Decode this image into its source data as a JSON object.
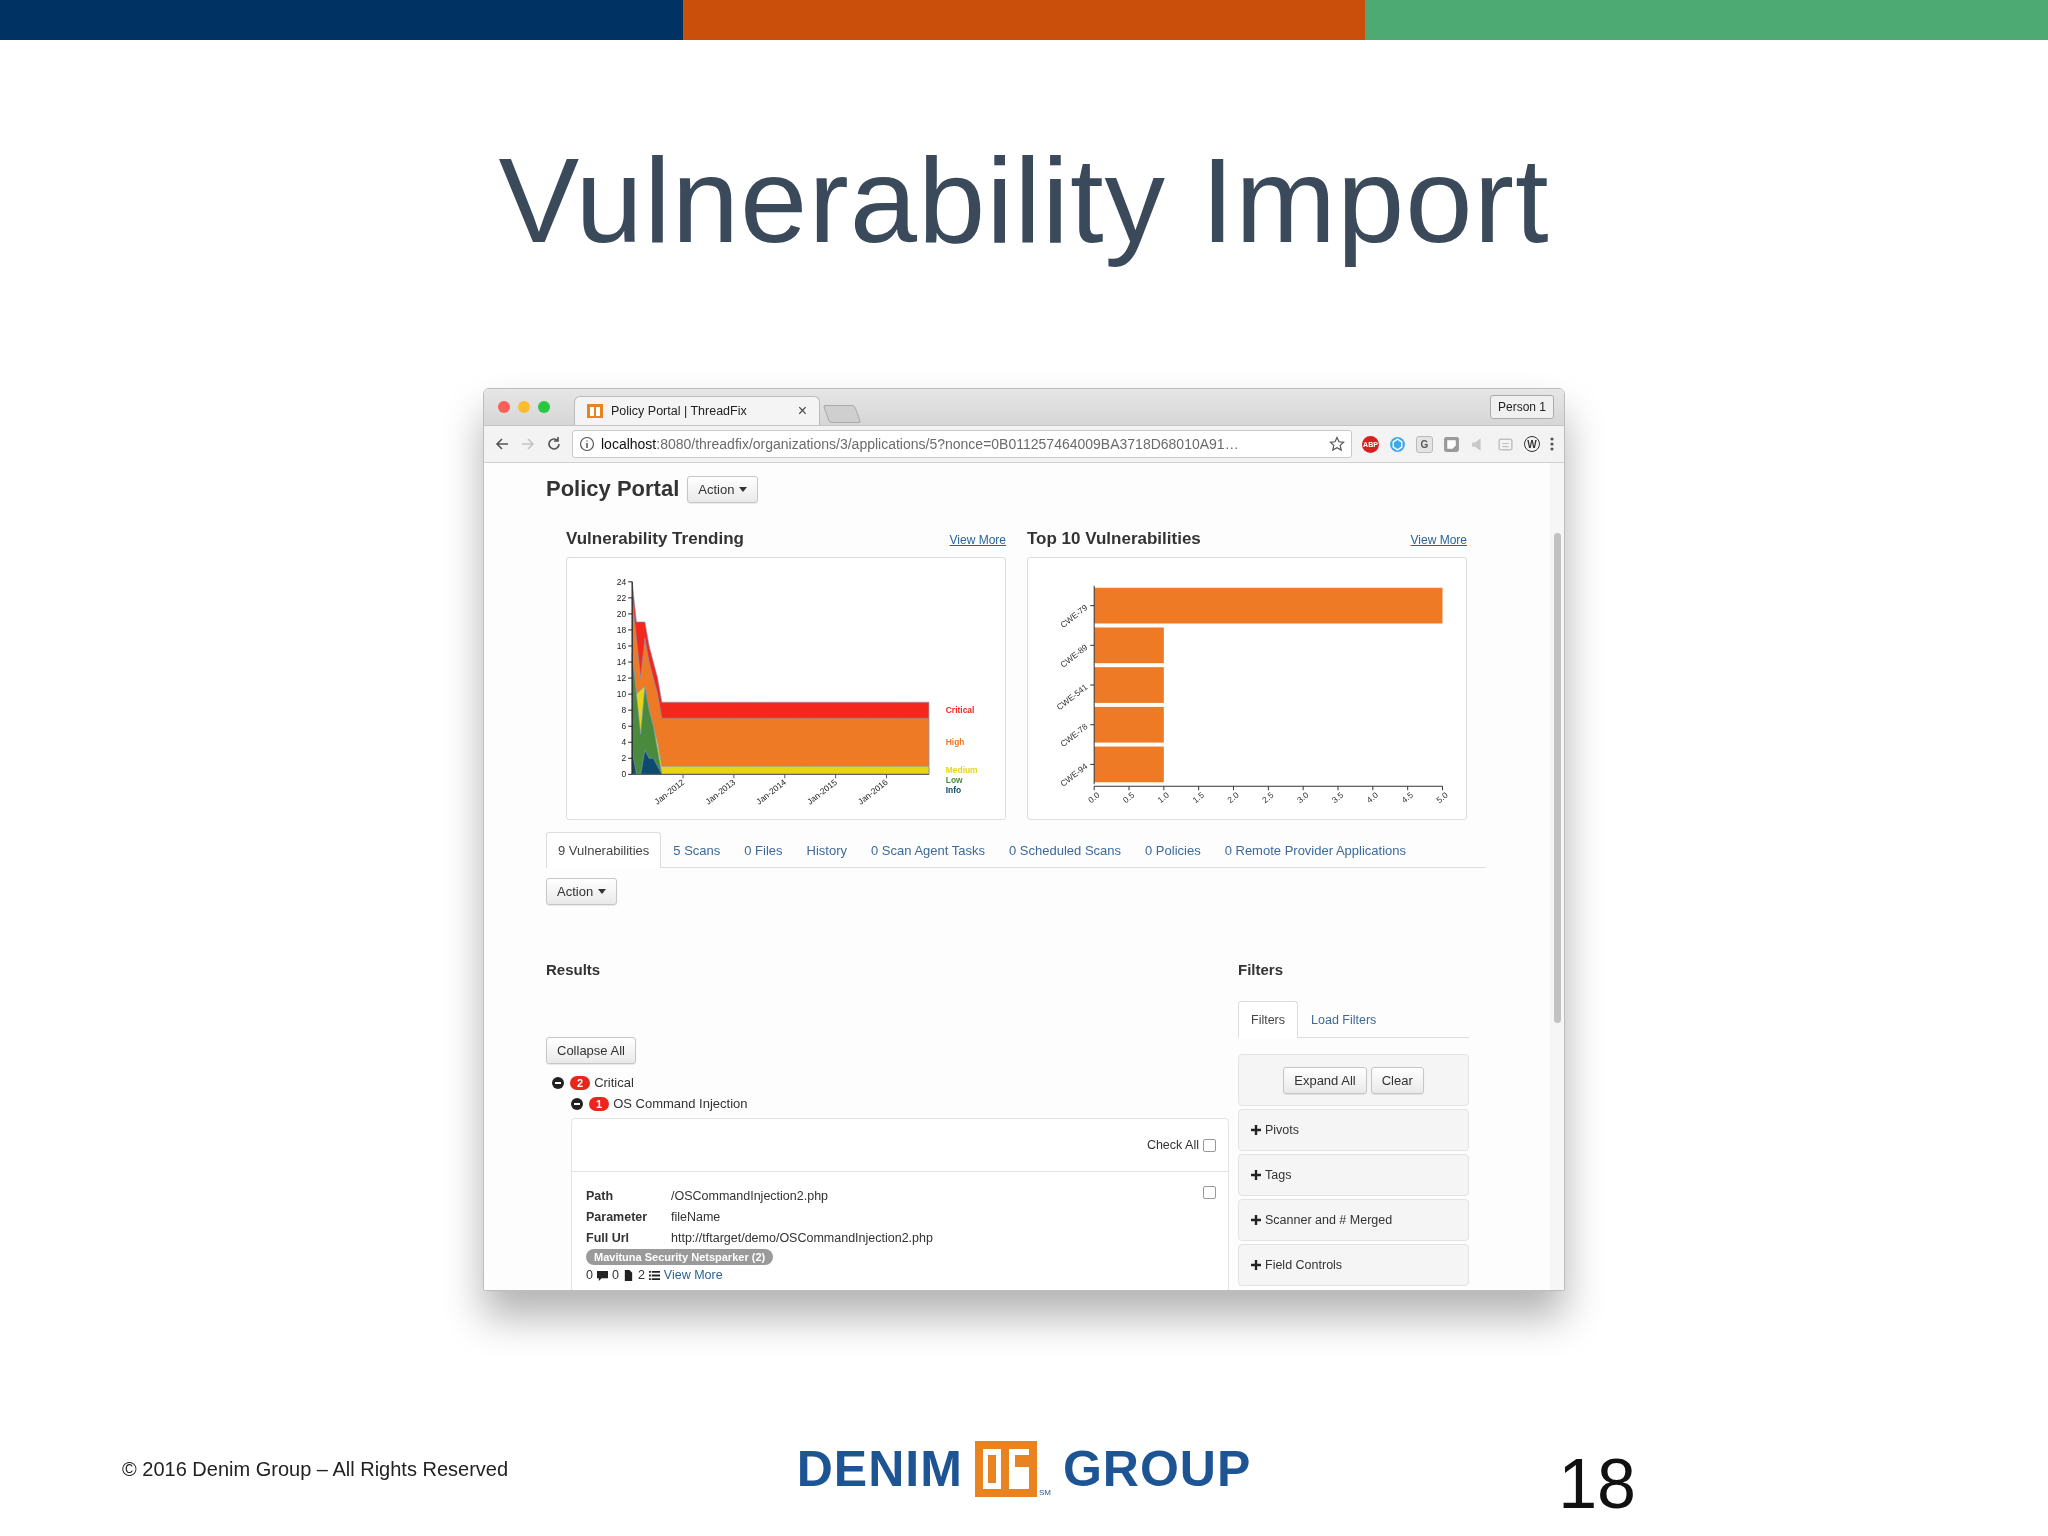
{
  "slide": {
    "title": "Vulnerability Import",
    "footer": {
      "copyright": "© 2016 Denim Group – All Rights Reserved",
      "logo_left": "DENIM",
      "logo_right": "GROUP",
      "logo_mark": "SM",
      "page_number": "18"
    }
  },
  "browser": {
    "tab_title": "Policy Portal | ThreadFix",
    "tab_close": "×",
    "profile": "Person 1",
    "back_disabled": false,
    "forward_disabled": true,
    "url_host": "localhost",
    "url_rest": ":8080/threadfix/organizations/3/applications/5?nonce=0B011257464009BA3718D68010A91…",
    "extensions": [
      {
        "kind": "abp",
        "label": "ABP"
      },
      {
        "kind": "cube"
      },
      {
        "kind": "letter",
        "label": "G"
      },
      {
        "kind": "note"
      },
      {
        "kind": "speaker"
      },
      {
        "kind": "box"
      },
      {
        "kind": "ring",
        "label": "W"
      }
    ]
  },
  "page": {
    "title": "Policy Portal",
    "action": "Action",
    "panels": [
      {
        "heading": "Vulnerability Trending",
        "link": "View More",
        "chart_data": {
          "type": "area",
          "stacked": false,
          "categories": [
            null,
            null,
            null,
            null,
            null,
            null,
            null,
            null,
            null,
            null,
            null,
            null,
            "Jan-2012",
            null,
            null,
            null,
            null,
            null,
            null,
            null,
            null,
            null,
            null,
            null,
            "Jan-2013",
            null,
            null,
            null,
            null,
            null,
            null,
            null,
            null,
            null,
            null,
            null,
            "Jan-2014",
            null,
            null,
            null,
            null,
            null,
            null,
            null,
            null,
            null,
            null,
            null,
            "Jan-2015",
            null,
            null,
            null,
            null,
            null,
            null,
            null,
            null,
            null,
            null,
            null,
            "Jan-2016",
            null,
            null,
            null,
            null,
            null,
            null,
            null,
            null,
            null,
            null
          ],
          "ylim": [
            0,
            24
          ],
          "yticks": [
            0,
            2,
            4,
            6,
            8,
            10,
            12,
            14,
            16,
            18,
            20,
            22,
            24
          ],
          "series": [
            {
              "name": "Info",
              "color": "#0c4a6e",
              "values": [
                3,
                0,
                0,
                3,
                2,
                2,
                1,
                0,
                null,
                null,
                null,
                null,
                null,
                null,
                null,
                null,
                null,
                null,
                null,
                null,
                null,
                null,
                null,
                null,
                null,
                null,
                null,
                null,
                null,
                null,
                null,
                null,
                null,
                null,
                null,
                null,
                null,
                null,
                null,
                null,
                null,
                null,
                null,
                null,
                null,
                null,
                null,
                null,
                null,
                null,
                null,
                null,
                null,
                null,
                null,
                null,
                null,
                null,
                null,
                null,
                null,
                null,
                null,
                null,
                null,
                null,
                null,
                null,
                null,
                null,
                null
              ]
            },
            {
              "name": "Low",
              "color": "#4a8a3c",
              "values": [
                15,
                10,
                5,
                11,
                8,
                6,
                3,
                0,
                null,
                null,
                null,
                null,
                null,
                null,
                null,
                null,
                null,
                null,
                null,
                null,
                null,
                null,
                null,
                null,
                null,
                null,
                null,
                null,
                null,
                null,
                null,
                null,
                null,
                null,
                null,
                null,
                null,
                null,
                null,
                null,
                null,
                null,
                null,
                null,
                null,
                null,
                null,
                null,
                null,
                null,
                null,
                null,
                null,
                null,
                null,
                null,
                null,
                null,
                null,
                null,
                null,
                null,
                null,
                null,
                null,
                null,
                null,
                null,
                null,
                null,
                null
              ]
            },
            {
              "name": "Medium",
              "color": "#e8d31a",
              "values": [
                15,
                10,
                null,
                11,
                8,
                6,
                4,
                1,
                1,
                1,
                1,
                1,
                1,
                1,
                1,
                1,
                1,
                1,
                1,
                1,
                1,
                1,
                1,
                1,
                1,
                1,
                1,
                1,
                1,
                1,
                1,
                1,
                1,
                1,
                1,
                1,
                1,
                1,
                1,
                1,
                1,
                1,
                1,
                1,
                1,
                1,
                1,
                1,
                1,
                1,
                1,
                1,
                1,
                1,
                1,
                1,
                1,
                1,
                1,
                1,
                1,
                1,
                1,
                1,
                1,
                1,
                1,
                1,
                1,
                1,
                1
              ]
            },
            {
              "name": "High",
              "color": "#ef7a26",
              "values": [
                22,
                17,
                12,
                17,
                14,
                12,
                10,
                7,
                7,
                7,
                7,
                7,
                7,
                7,
                7,
                7,
                7,
                7,
                7,
                7,
                7,
                7,
                7,
                7,
                7,
                7,
                7,
                7,
                7,
                7,
                7,
                7,
                7,
                7,
                7,
                7,
                7,
                7,
                7,
                7,
                7,
                7,
                7,
                7,
                7,
                7,
                7,
                7,
                7,
                7,
                7,
                7,
                7,
                7,
                7,
                7,
                7,
                7,
                7,
                7,
                7,
                7,
                7,
                7,
                7,
                7,
                7,
                7,
                7,
                7,
                7
              ]
            },
            {
              "name": "Critical",
              "color": "#f3271c",
              "values": [
                24,
                19,
                null,
                19,
                16,
                14,
                12,
                9,
                9,
                9,
                9,
                9,
                9,
                9,
                9,
                9,
                9,
                9,
                9,
                9,
                9,
                9,
                9,
                9,
                9,
                9,
                9,
                9,
                9,
                9,
                9,
                9,
                9,
                9,
                9,
                9,
                9,
                9,
                9,
                9,
                9,
                9,
                9,
                9,
                9,
                9,
                9,
                9,
                9,
                9,
                9,
                9,
                9,
                9,
                9,
                9,
                9,
                9,
                9,
                9,
                9,
                9,
                9,
                9,
                9,
                9,
                9,
                9,
                9,
                9,
                9
              ]
            }
          ]
        }
      },
      {
        "heading": "Top 10 Vulnerabilities",
        "link": "View More",
        "chart_data": {
          "type": "bar",
          "orientation": "horizontal",
          "categories": [
            "CWE-79",
            "CWE-89",
            "CWE-541",
            "CWE-78",
            "CWE-94"
          ],
          "series": [
            {
              "color": "#ef7a26",
              "values": [
                5,
                1,
                1,
                1,
                1
              ]
            }
          ],
          "xlim": [
            0,
            5
          ],
          "xticks": [
            {
              "value": 0,
              "label": "0.0"
            },
            {
              "value": 0.5,
              "label": "0.5"
            },
            {
              "value": 1,
              "label": "1.0"
            },
            {
              "value": 1.5,
              "label": "1.5"
            },
            {
              "value": 2,
              "label": "2.0"
            },
            {
              "value": 2.5,
              "label": "2.5"
            },
            {
              "value": 3,
              "label": "3.0"
            },
            {
              "value": 3.5,
              "label": "3.5"
            },
            {
              "value": 4,
              "label": "4.0"
            },
            {
              "value": 4.5,
              "label": "4.5"
            },
            {
              "value": 5,
              "label": "5.0"
            }
          ]
        }
      }
    ],
    "tabs": [
      {
        "label": "9 Vulnerabilities",
        "selected": true
      },
      {
        "label": "5 Scans",
        "selected": false
      },
      {
        "label": "0 Files",
        "selected": false
      },
      {
        "label": "History",
        "selected": false
      },
      {
        "label": "0 Scan Agent Tasks",
        "selected": false
      },
      {
        "label": "0 Scheduled Scans",
        "selected": false
      },
      {
        "label": "0 Policies",
        "selected": false
      },
      {
        "label": "0 Remote Provider Applications",
        "selected": false
      }
    ],
    "action_2": "Action",
    "results": {
      "heading": "Results",
      "collapse": "Collapse All",
      "tree": [
        {
          "count": "2",
          "label": "Critical",
          "expanded": true,
          "children": [
            {
              "count": "1",
              "label": "OS Command Injection",
              "expanded": true
            }
          ]
        }
      ],
      "check_all": "Check All",
      "check_all_checked": false,
      "vulnerability": {
        "checked": false,
        "fields": [
          {
            "label": "Path",
            "value": "/OSCommandInjection2.php"
          },
          {
            "label": "Parameter",
            "value": "fileName"
          },
          {
            "label": "Full Url",
            "value": "http://tftarget/demo/OSCommandInjection2.php"
          }
        ],
        "scanner_tag": "Mavituna Security Netsparker (2)",
        "comments": "0",
        "files": "0",
        "scans": "2",
        "link": "View More"
      }
    },
    "filters": {
      "heading": "Filters",
      "tabs": [
        {
          "label": "Filters",
          "selected": true
        },
        {
          "label": "Load Filters",
          "selected": false
        }
      ],
      "buttons": [
        "Expand All",
        "Clear"
      ],
      "sections": [
        {
          "label": "Pivots",
          "expanded": false
        },
        {
          "label": "Tags",
          "expanded": false
        },
        {
          "label": "Scanner and # Merged",
          "expanded": false
        },
        {
          "label": "Field Controls",
          "expanded": false
        }
      ]
    }
  }
}
